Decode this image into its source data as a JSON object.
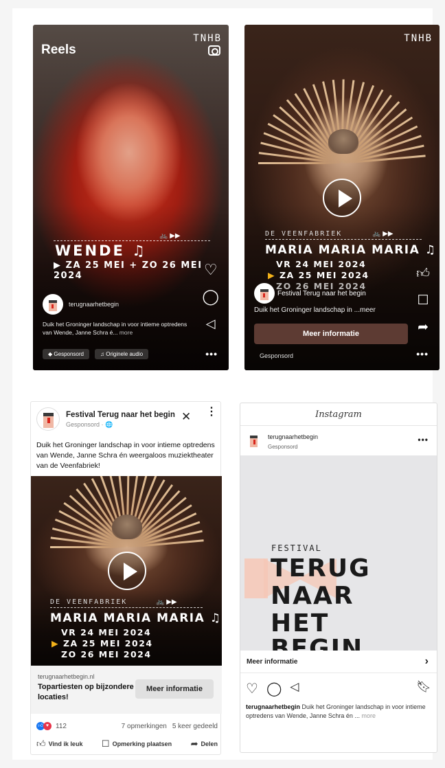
{
  "reel1": {
    "title": "Reels",
    "brand": "TNHB",
    "artist": "WENDE ♫",
    "dates": "▶ ZA 25 MEI + ZO 26 MEI 2024",
    "bike_icons": "🚲 ▶▶",
    "account": "terugnaarhetbegin",
    "caption_main": "Duik het Groninger landschap in voor intieme optredens van Wende, Janne Schra é...",
    "caption_more": "more",
    "chip_sponsored": "Gesponsord",
    "chip_audio": "Originele audio",
    "chip_sponsored_icon": "◆",
    "chip_audio_icon": "♫",
    "icons": [
      "heart-icon",
      "comment-icon",
      "share-icon"
    ],
    "more": "•••"
  },
  "reel2": {
    "brand": "TNHB",
    "venue": "DE VEENFABRIEK",
    "show": "MARIA MARIA MARIA ♫",
    "date1": "VR 24 MEI 2024",
    "date2": "ZA 25 MEI 2024",
    "date3": "ZO 26 MEI 2024",
    "bike_icons": "🚲 ▶▶",
    "account": "Festival Terug naar het begin",
    "caption_main": "Duik het Groninger landschap in",
    "caption_more": "...meer",
    "cta": "Meer informatie",
    "sponsored": "Gesponsord",
    "icons": [
      "thumbs-up-icon",
      "comment-icon",
      "share-icon"
    ],
    "more": "•••"
  },
  "fb": {
    "page_name": "Festival Terug naar het begin",
    "sponsored": "Gesponsord · 🌐",
    "body": "Duik het Groninger landschap in voor intieme optredens van Wende, Janne Schra én weergaloos muziektheater van de Veenfabriek!",
    "venue": "DE VEENFABRIEK",
    "show": "MARIA MARIA MARIA ♫",
    "date1": "VR 24 MEI 2024",
    "date2": "ZA 25 MEI 2024",
    "date3": "ZO 26 MEI 2024",
    "bike_icons": "🚲 ▶▶",
    "domain": "terugnaarhetbegin.nl",
    "headline": "Topartiesten op bijzondere locaties!",
    "cta": "Meer informatie",
    "reaction_count": "112",
    "comments": "7 opmerkingen",
    "shares": "5 keer gedeeld",
    "like": "Vind ik leuk",
    "comment": "Opmerking plaatsen",
    "share": "Delen",
    "close": "✕",
    "kebab": "⋮"
  },
  "ig": {
    "app": "Instagram",
    "account": "terugnaarhetbegin",
    "sponsored": "Gesponsord",
    "festival": "FESTIVAL",
    "line1": "TERUG",
    "line2": "NAAR",
    "line3": "HET",
    "line4": "BEGIN",
    "cta": "Meer informatie",
    "caption_user": "terugnaarhetbegin",
    "caption_main": "Duik het Groninger landschap in voor intieme optredens van Wende, Janne Schra én ...",
    "caption_more": "more",
    "more": "•••",
    "chevron": "›"
  }
}
